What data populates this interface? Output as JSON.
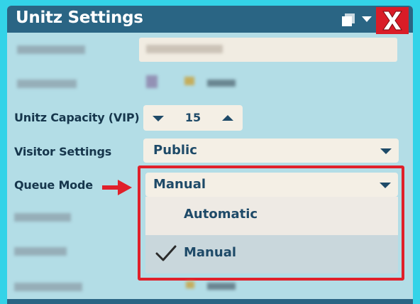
{
  "window": {
    "title": "Unitz Settings"
  },
  "rows": {
    "capacity": {
      "label": "Unitz Capacity (VIP)",
      "value": "15"
    },
    "visitor": {
      "label": "Visitor Settings",
      "selected": "Public"
    },
    "queue": {
      "label": "Queue Mode",
      "selected": "Manual",
      "options": [
        {
          "label": "Automatic",
          "checked": false
        },
        {
          "label": "Manual",
          "checked": true
        }
      ]
    }
  },
  "colors": {
    "titlebar": "#2a6584",
    "close": "#d91c27",
    "highlight": "#e0202a",
    "label_text": "#16364c"
  },
  "icons": [
    "restore-icon",
    "caret-down-icon",
    "close-icon",
    "chevron-down-icon",
    "chevron-up-icon",
    "checkmark-icon",
    "arrow-right-icon"
  ]
}
